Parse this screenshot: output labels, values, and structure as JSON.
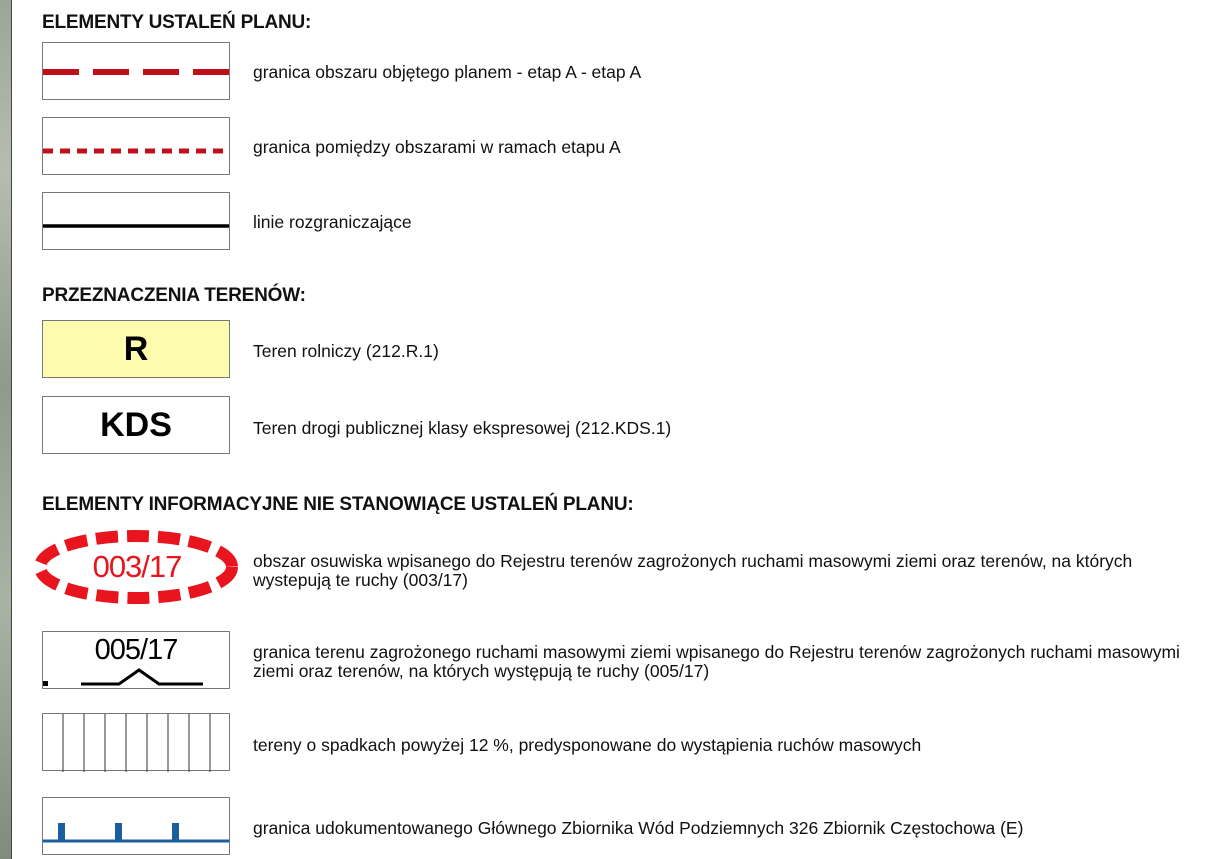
{
  "headings": {
    "ustalenia": "ELEMENTY USTALEŃ PLANU:",
    "przeznaczenia": "PRZEZNACZENIA TERENÓW:",
    "informacyjne": "ELEMENTY INFORMACYJNE NIE STANOWIĄCE USTALEŃ PLANU:"
  },
  "ustalenia": [
    {
      "icon": "red-dashed-line-icon",
      "label": "granica obszaru objętego planem - etap A - etap A"
    },
    {
      "icon": "red-dotted-line-icon",
      "label": "granica pomiędzy obszarami w ramach etapu A"
    },
    {
      "icon": "black-solid-line-icon",
      "label": "linie rozgraniczające"
    }
  ],
  "przeznaczenia": [
    {
      "code": "R",
      "label": "Teren rolniczy (212.R.1)",
      "fill": "#fdfcae"
    },
    {
      "code": "KDS",
      "label": "Teren drogi publicznej klasy ekspresowej (212.KDS.1)",
      "fill": "#ffffff"
    }
  ],
  "informacyjne": [
    {
      "symbol_text": "003/17",
      "label": "obszar osuwiska wpisanego do Rejestru terenów zagrożonych ruchami masowymi ziemi oraz terenów, na których wystepują te ruchy (003/17)",
      "color": "#e8141e"
    },
    {
      "symbol_text": "005/17",
      "label": "granica terenu zagrożonego ruchami masowymi ziemi wpisanego do Rejestru terenów zagrożonych ruchami masowymi ziemi oraz terenów, na których występują te ruchy (005/17)"
    },
    {
      "icon": "vertical-hatching-icon",
      "label": "tereny o spadkach powyżej 12 %, predysponowane do wystąpienia ruchów masowych"
    },
    {
      "icon": "blue-comb-line-icon",
      "label": "granica udokumentowanego Głównego Zbiornika Wód Podziemnych 326 Zbiornik Częstochowa (E)",
      "color": "#1b5e9e"
    }
  ],
  "colors": {
    "boundary_red": "#c0111a",
    "water_blue": "#1b5e9e"
  }
}
